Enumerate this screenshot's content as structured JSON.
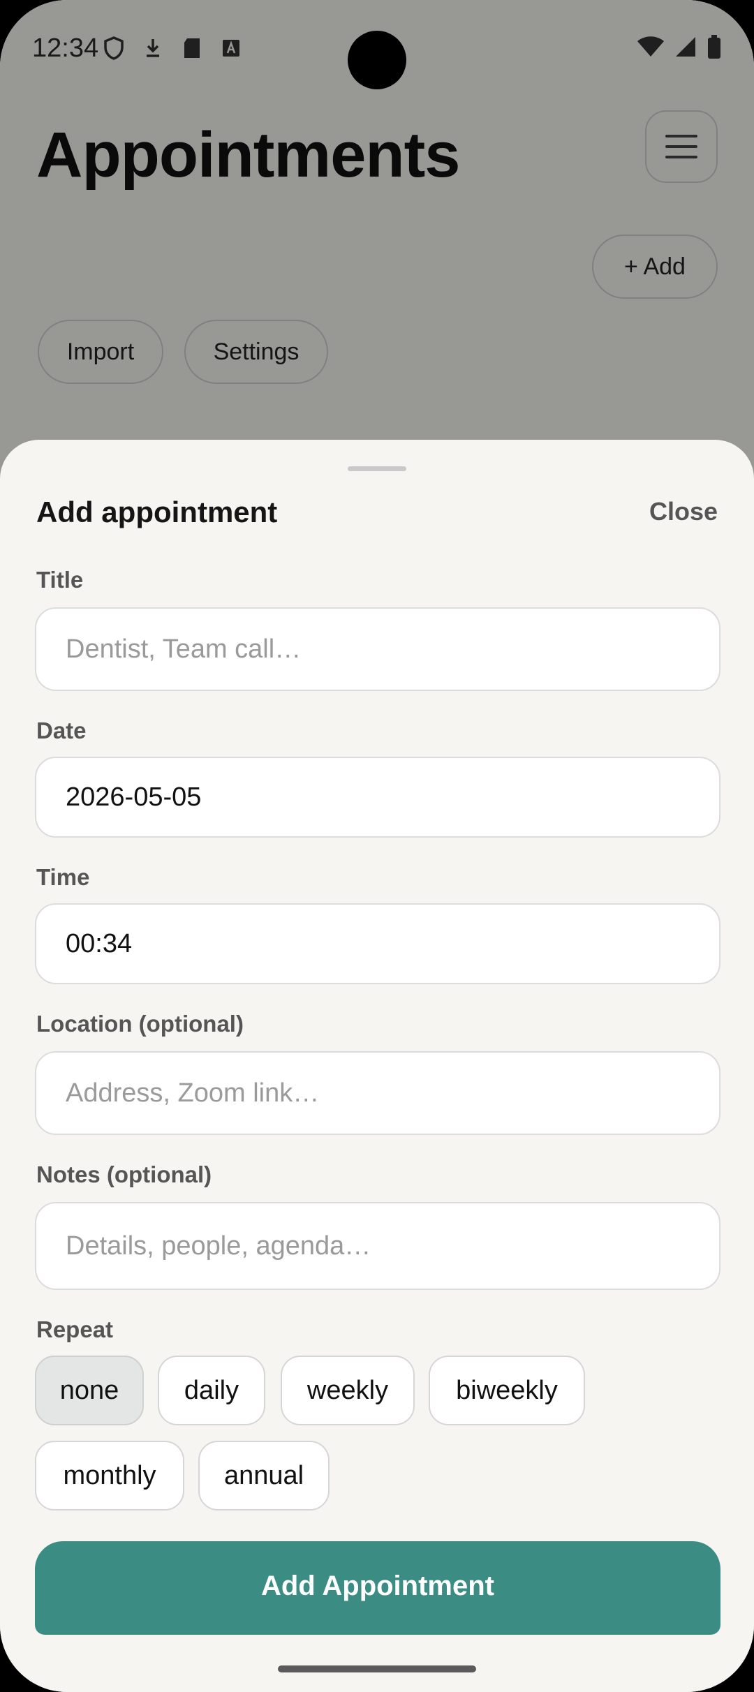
{
  "status_bar": {
    "time": "12:34"
  },
  "background": {
    "title": "Appointments",
    "add_label": "+ Add",
    "import_label": "Import",
    "settings_label": "Settings"
  },
  "sheet": {
    "title": "Add appointment",
    "close_label": "Close",
    "fields": {
      "title": {
        "label": "Title",
        "placeholder": "Dentist, Team call…",
        "value": ""
      },
      "date": {
        "label": "Date",
        "value": "2026-05-05"
      },
      "time": {
        "label": "Time",
        "value": "00:34"
      },
      "location": {
        "label": "Location (optional)",
        "placeholder": "Address, Zoom link…",
        "value": ""
      },
      "notes": {
        "label": "Notes (optional)",
        "placeholder": "Details, people, agenda…",
        "value": ""
      }
    },
    "repeat": {
      "label": "Repeat",
      "selected": "none",
      "options": [
        "none",
        "daily",
        "weekly",
        "biweekly",
        "monthly",
        "annual"
      ]
    },
    "submit_label": "Add Appointment"
  },
  "colors": {
    "accent": "#3b8c82",
    "sheet_bg": "#f6f5f1",
    "scrim": "rgba(0,0,0,0.38)"
  }
}
